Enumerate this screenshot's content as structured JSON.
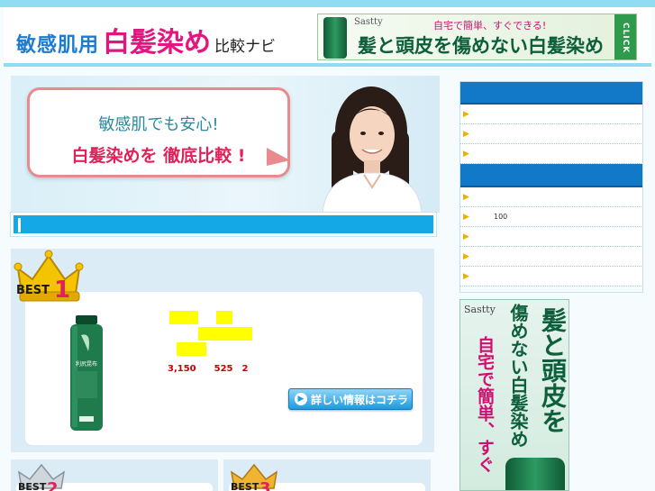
{
  "header": {
    "logo_part1": "敏感肌用",
    "logo_part2": "白髪染め",
    "logo_part3": "比較ナビ",
    "banner": {
      "brand": "Sastty",
      "top_text": "自宅で簡単、すぐできる!",
      "main_text": "髪と頭皮を傷めない白髪染め",
      "click_label": "CLICK"
    }
  },
  "hero": {
    "line1": "敏感肌でも安心!",
    "line2": "白髪染めを 徹底比較 !"
  },
  "ranking": {
    "best1": {
      "badge": "BEST",
      "rank": "1",
      "product_label": "利尻昆布",
      "price_text": "3,150　　525　2",
      "detail_button": "詳しい情報はコチラ"
    },
    "best2": {
      "badge": "BEST",
      "rank": "2"
    },
    "best3": {
      "badge": "BEST",
      "rank": "3"
    }
  },
  "sidebar": {
    "items1": [
      "",
      "",
      ""
    ],
    "items2": [
      "",
      "100",
      "",
      "",
      ""
    ]
  },
  "side_banner": {
    "brand": "Sastty",
    "col1": "髪と頭皮を",
    "col2": "傷めない白髪染め",
    "col3": "自宅で簡単、すぐ"
  },
  "colors": {
    "accent_blue": "#1179c8",
    "header_cyan": "#8fdcf3",
    "pink": "#e4157f",
    "highlight": "#ffff00"
  }
}
